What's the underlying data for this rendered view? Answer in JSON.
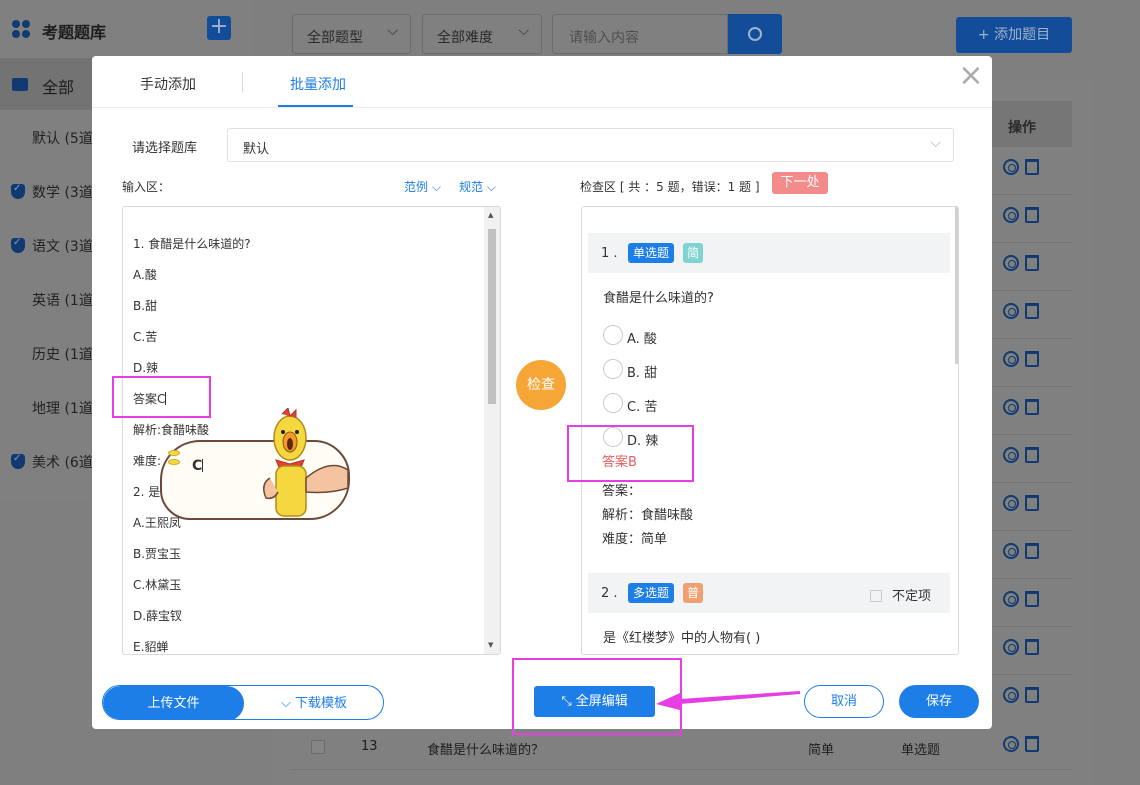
{
  "sidebar": {
    "title": "考题题库",
    "add_label": "+",
    "all_label": "全部",
    "items": [
      {
        "label": "默认 (5道",
        "checked": false
      },
      {
        "label": "数学 (3道",
        "checked": true
      },
      {
        "label": "语文 (3道",
        "checked": true
      },
      {
        "label": "英语 (1道",
        "checked": false
      },
      {
        "label": "历史 (1道",
        "checked": false
      },
      {
        "label": "地理 (1道",
        "checked": false
      },
      {
        "label": "美术 (6道",
        "checked": true
      }
    ]
  },
  "toolbar": {
    "type_select": "全部题型",
    "difficulty_select": "全部难度",
    "search_placeholder": "请输入内容",
    "add_question": "+ 添加题目"
  },
  "table": {
    "op_header": "操作",
    "bottom_row": {
      "index": "13",
      "question": "食醋是什么味道的？",
      "difficulty": "简单",
      "type": "单选题"
    }
  },
  "modal": {
    "tabs": [
      "手动添加",
      "批量添加"
    ],
    "active_tab": "批量添加",
    "close": "×",
    "bank_label": "请选择题库",
    "bank_value": "默认",
    "input_label": "输入区：",
    "example_link": "范例",
    "rules_link": "规范",
    "input_lines": [
      "1. 食醋是什么味道的?",
      "A.酸",
      "B.甜",
      "C.苦",
      "D.辣",
      "答案C",
      "解析:食醋味酸",
      "难度:",
      "2. 是",
      "A.王熙凤",
      "B.贾宝玉",
      "C.林黛玉",
      "D.薛宝钗",
      "E.貂蝉"
    ],
    "check_button": "检查",
    "check_label": "检查区 [ 共 ：5 题，错误：1 题 ]",
    "next_error": "下一处",
    "q1": {
      "num": "1 .",
      "type_tag": "单选题",
      "diff_tag": "简",
      "text": "食醋是什么味道的?",
      "options": [
        "A.  酸",
        "B.  甜",
        "C.  苦",
        "D.  辣"
      ],
      "error_note": "答案B",
      "answer": "答案：",
      "analysis": "解析：食醋味酸",
      "difficulty": "难度：简单"
    },
    "q2": {
      "num": "2 .",
      "type_tag": "多选题",
      "diff_tag": "普",
      "indefinite": "不定项",
      "text": "是《红楼梦》中的人物有( )"
    },
    "upload": "上传文件",
    "download": "下载模板",
    "fullscreen": "全屏编辑",
    "cancel": "取消",
    "save": "保存"
  },
  "annotation": {
    "sticker_text": "C",
    "color": "#e53ee5"
  },
  "colors": {
    "primary": "#1e7ee8",
    "check_orange": "#f5a637",
    "error_red": "#e55e5e",
    "tag_simple": "#7fd3d0",
    "tag_normal": "#f0a070"
  }
}
